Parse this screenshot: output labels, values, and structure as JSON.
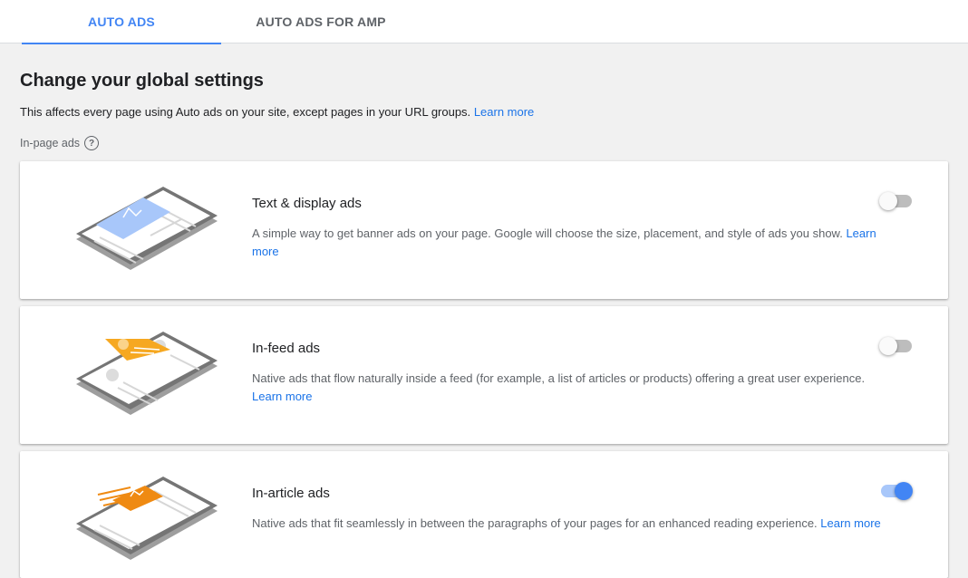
{
  "tabs": [
    {
      "label": "AUTO ADS",
      "active": true
    },
    {
      "label": "AUTO ADS FOR AMP",
      "active": false
    }
  ],
  "page": {
    "title": "Change your global settings",
    "subtitle": "This affects every page using Auto ads on your site, except pages in your URL groups.",
    "subtitle_link": "Learn more",
    "section_label": "In-page ads",
    "help_icon": "help-circle-icon"
  },
  "cards": [
    {
      "title": "Text & display ads",
      "description": "A simple way to get banner ads on your page. Google will choose the size, placement, and style of ads you show.",
      "link": "Learn more",
      "enabled": false,
      "accent_color": "#a8c7fa"
    },
    {
      "title": "In-feed ads",
      "description": "Native ads that flow naturally inside a feed (for example, a list of articles or products) offering a great user experience.",
      "link": "Learn more",
      "enabled": false,
      "accent_color": "#f6a821"
    },
    {
      "title": "In-article ads",
      "description": "Native ads that fit seamlessly in between the paragraphs of your pages for an enhanced reading experience.",
      "link": "Learn more",
      "enabled": true,
      "accent_color": "#ef8a12"
    }
  ],
  "colors": {
    "primary": "#4285f4",
    "link": "#1a73e8",
    "toggle_off": "#bdbdbd",
    "page_bg": "#f1f1f1"
  }
}
